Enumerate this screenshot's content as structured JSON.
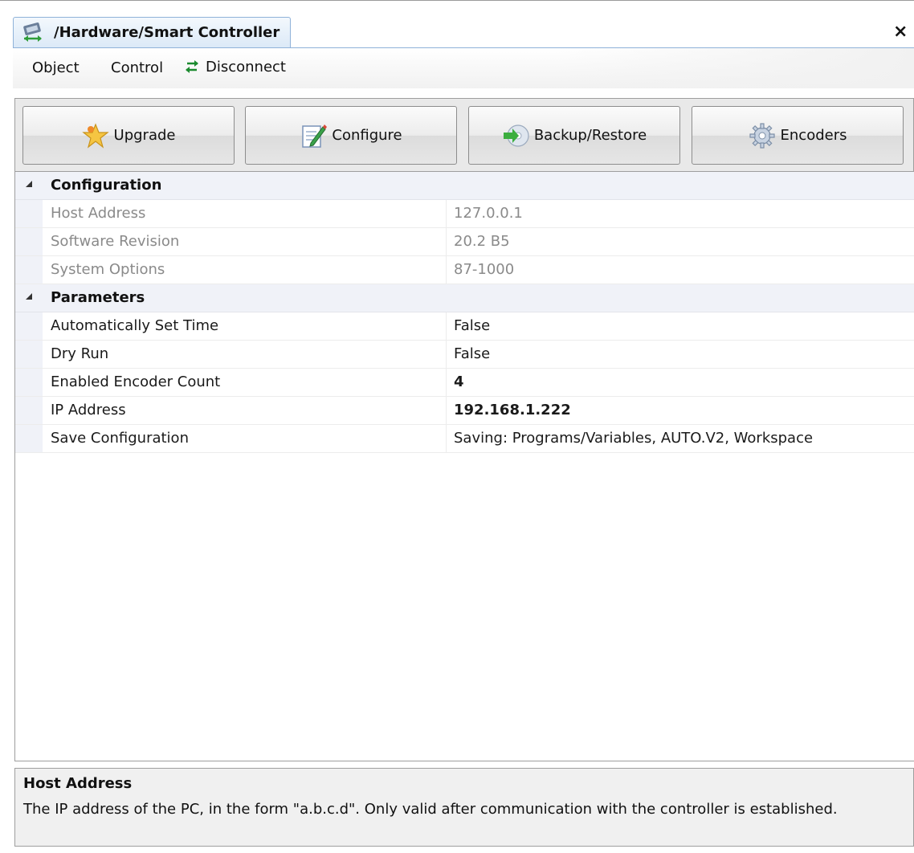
{
  "tab": {
    "title": "/Hardware/Smart Controller",
    "close_label": "×"
  },
  "menu": {
    "object": "Object",
    "control": "Control",
    "disconnect": "Disconnect"
  },
  "toolbar": {
    "upgrade": "Upgrade",
    "configure": "Configure",
    "backup_restore": "Backup/Restore",
    "encoders": "Encoders"
  },
  "grid": {
    "configuration": {
      "label": "Configuration",
      "rows": [
        {
          "name": "Host Address",
          "value": "127.0.0.1"
        },
        {
          "name": "Software Revision",
          "value": "20.2 B5"
        },
        {
          "name": "System Options",
          "value": "87-1000"
        }
      ]
    },
    "parameters": {
      "label": "Parameters",
      "rows": [
        {
          "name": "Automatically Set Time",
          "value": "False"
        },
        {
          "name": "Dry Run",
          "value": "False"
        },
        {
          "name": "Enabled Encoder Count",
          "value": "4"
        },
        {
          "name": "IP Address",
          "value": "192.168.1.222"
        },
        {
          "name": "Save Configuration",
          "value": "Saving: Programs/Variables, AUTO.V2, Workspace"
        }
      ]
    }
  },
  "description": {
    "title": "Host Address",
    "text": "The IP address of the PC, in the form \"a.b.c.d\". Only valid after communication with the controller is established."
  },
  "colors": {
    "tab_border": "#8fb2d9",
    "category_bg": "#f0f2f8",
    "readonly_text": "#8a8a8a"
  },
  "icons": {
    "tab": "controller-icon",
    "disconnect": "swap-arrows-icon",
    "upgrade": "star-icon",
    "configure": "edit-document-icon",
    "backup": "disc-arrow-icon",
    "encoders": "gear-icon"
  }
}
